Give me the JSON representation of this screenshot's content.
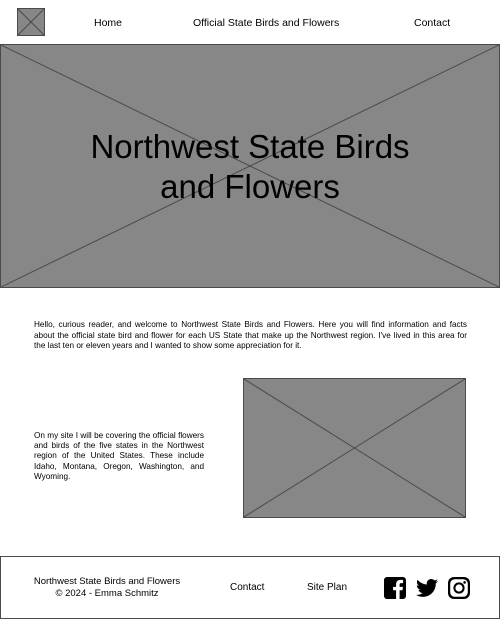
{
  "header": {
    "logo_icon": "image-placeholder-icon",
    "nav": [
      {
        "label": "Home"
      },
      {
        "label": "Official State Birds and Flowers"
      },
      {
        "label": "Contact"
      }
    ]
  },
  "hero": {
    "image_icon": "image-placeholder-icon",
    "title_line1": "Northwest State Birds",
    "title_line2": "and Flowers"
  },
  "content": {
    "intro": "Hello, curious reader, and welcome to Northwest State Birds and Flowers. Here you will find information and facts about the official state bird and flower for each US State that make up the Northwest region. I've lived in this area for the last ten or eleven years and I wanted to show some appreciation for it.",
    "covering": "On my site I will be covering the official flowers and birds of the five states in the Northwest region of the United States. These include Idaho, Montana, Oregon, Washington, and Wyoming.",
    "side_image_icon": "image-placeholder-icon"
  },
  "footer": {
    "brand_line1": "Northwest State Birds and Flowers",
    "brand_line2": "© 2024 - Emma Schmitz",
    "links": [
      {
        "label": "Contact"
      },
      {
        "label": "Site Plan"
      }
    ],
    "social_icons": [
      "facebook-icon",
      "twitter-icon",
      "instagram-icon"
    ]
  },
  "colors": {
    "placeholder_fill": "#878787",
    "border": "#4a4a4a",
    "text": "#000000"
  }
}
